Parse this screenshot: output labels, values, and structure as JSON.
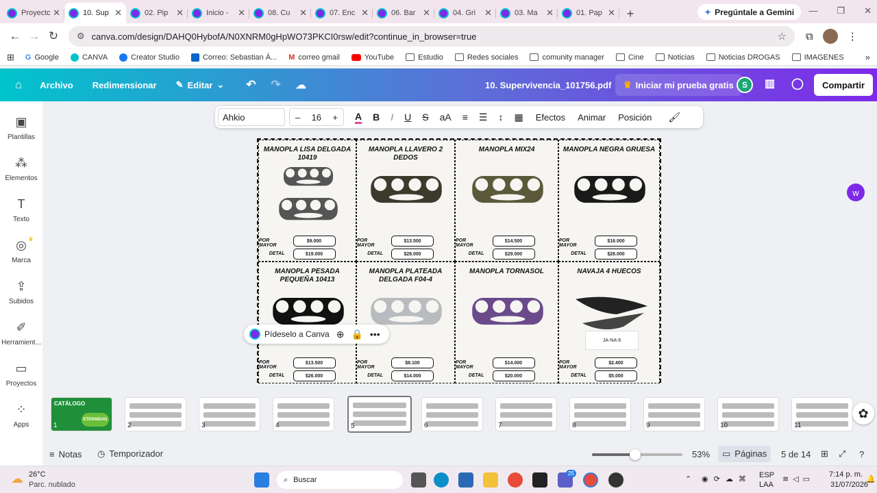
{
  "tabs": [
    {
      "label": "Proyecto",
      "active": false
    },
    {
      "label": "10. Sup",
      "active": true
    },
    {
      "label": "02. Pip",
      "active": false
    },
    {
      "label": "Inicio -",
      "active": false
    },
    {
      "label": "08. Cu",
      "active": false
    },
    {
      "label": "07. Enc",
      "active": false
    },
    {
      "label": "06. Bar",
      "active": false
    },
    {
      "label": "04. Gri",
      "active": false
    },
    {
      "label": "03. Ma",
      "active": false
    },
    {
      "label": "01. Pap",
      "active": false
    }
  ],
  "gemini_button": "Pregúntale a Gemini",
  "address": "canva.com/design/DAHQ0HybofA/N0XNRM0gHpWO73PKCI0rsw/edit?continue_in_browser=true",
  "bookmarks": [
    "Google",
    "CANVA",
    "Creator Studio",
    "Correo: Sebastian Á...",
    "correo gmail",
    "YouTube",
    "Estudio",
    "Redes sociales",
    "comunity manager",
    "Cine",
    "Noticias",
    "Noticias DROGAS",
    "IMAGENES"
  ],
  "canva_header": {
    "archivo": "Archivo",
    "redimensionar": "Redimensionar",
    "editar": "Editar",
    "doc_name": "10. Supervivencia_101756.pdf",
    "trial": "Iniciar mi prueba gratis",
    "avatar_letter": "S",
    "share": "Compartir"
  },
  "left_rail": [
    "Plantillas",
    "Elementos",
    "Texto",
    "Marca",
    "Subidos",
    "Herramient...",
    "Proyectos",
    "Apps"
  ],
  "format_bar": {
    "font": "Ahkio",
    "size": "16",
    "efectos": "Efectos",
    "animar": "Animar",
    "posicion": "Posición"
  },
  "price_labels": {
    "mayor": "POR MAYOR",
    "detal": "DETAL"
  },
  "products": [
    {
      "title": "MANOPLA LISA DELGADA 10419",
      "mayor": "$9.000",
      "detal": "$19.000",
      "color": "#555"
    },
    {
      "title": "MANOPLA LLAVERO 2 DEDOS",
      "mayor": "$13.500",
      "detal": "$28.000",
      "color": "#3b3a2c"
    },
    {
      "title": "MANOPLA MIX24",
      "mayor": "$14.500",
      "detal": "$29.000",
      "color": "#5a5a3a"
    },
    {
      "title": "MANOPLA NEGRA GRUESA",
      "mayor": "$16.000",
      "detal": "$28.000",
      "color": "#1a1a1a"
    },
    {
      "title": "MANOPLA PESADA PEQUEÑA 10413",
      "mayor": "$13.500",
      "detal": "$26.000",
      "color": "#111"
    },
    {
      "title": "MANOPLA PLATEADA DELGADA F04-4",
      "mayor": "$8.100",
      "detal": "$14.000",
      "color": "#b8bcbe"
    },
    {
      "title": "MANOPLA TORNASOL",
      "mayor": "$14.000",
      "detal": "$20.000",
      "color": "#6a4a8a"
    },
    {
      "title": "NAVAJA 4 HUECOS",
      "mayor": "$2.400",
      "detal": "$5.000",
      "color": "#222"
    }
  ],
  "knife_tag": "JA-NA-6",
  "floating_bar": {
    "label": "Pídeselo a Canva"
  },
  "thumbnail_numbers": [
    "1",
    "2",
    "3",
    "4",
    "5",
    "6",
    "7",
    "8",
    "9",
    "10",
    "11"
  ],
  "thumbnail_cover": {
    "title": "CATÁLOGO",
    "badge": "ETERNIDAD"
  },
  "bottom_bar": {
    "notas": "Notas",
    "temporizador": "Temporizador",
    "zoom": "53%",
    "paginas": "Páginas",
    "page_count": "5 de 14",
    "zoom_level": 0.53
  },
  "taskbar": {
    "temp": "26°C",
    "weather": "Parc. nublado",
    "search": "Buscar",
    "lang1": "ESP",
    "lang2": "LAA",
    "time": "7:14 p. m.",
    "date": "31/07/2026",
    "badge": "25"
  }
}
